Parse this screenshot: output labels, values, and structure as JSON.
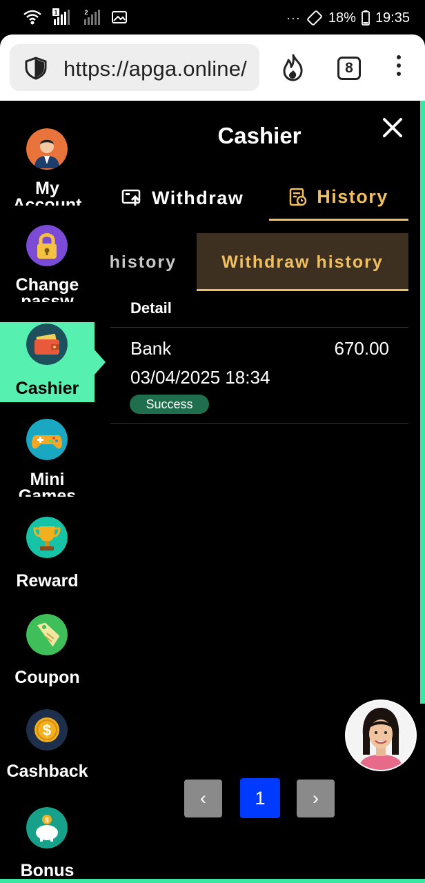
{
  "status_bar": {
    "battery": "18%",
    "time": "19:35",
    "sim1": "1",
    "sim2": "2"
  },
  "browser": {
    "url": "https://apga.online/",
    "tab_count": "8"
  },
  "sidebar": {
    "items": [
      {
        "label": "My Account",
        "icon": "account-icon"
      },
      {
        "label": "Change passw",
        "icon": "lock-icon"
      },
      {
        "label": "Cashier",
        "icon": "wallet-icon",
        "active": true
      },
      {
        "label": "Mini Games",
        "icon": "gamepad-icon"
      },
      {
        "label": "Reward",
        "icon": "trophy-icon"
      },
      {
        "label": "Coupon",
        "icon": "coupon-icon"
      },
      {
        "label": "Cashback",
        "icon": "coin-icon"
      },
      {
        "label": "Bonus",
        "icon": "piggy-bank-icon"
      }
    ]
  },
  "panel": {
    "title": "Cashier",
    "tabs": [
      {
        "label": "Withdraw",
        "icon": "withdraw-icon"
      },
      {
        "label": "History",
        "icon": "history-icon",
        "active": true
      }
    ],
    "subtabs": [
      {
        "label": "history"
      },
      {
        "label": "Withdraw history",
        "active": true
      }
    ],
    "table": {
      "header": "Detail",
      "rows": [
        {
          "method": "Bank",
          "amount": "670.00",
          "datetime": "03/04/2025 18:34",
          "status": "Success"
        }
      ]
    }
  },
  "pagination": {
    "prev": "‹",
    "current": "1",
    "next": "›"
  },
  "colors": {
    "accent_green": "#56f0b0",
    "gold": "#f0c060",
    "success_bg": "#1f6e4d",
    "page_active": "#0039ff"
  }
}
